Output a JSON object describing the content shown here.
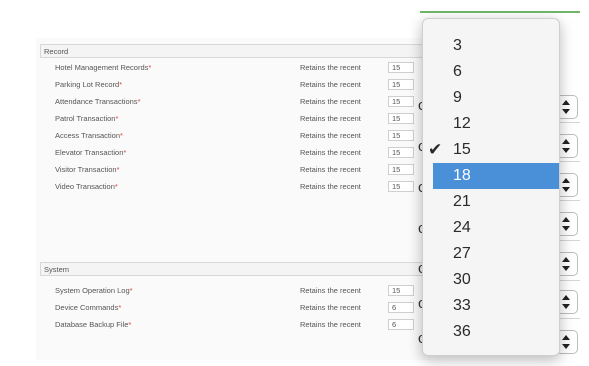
{
  "record_section": {
    "title": "Record",
    "rows": [
      {
        "name": "Hotel Management Records",
        "retain_label": "Retains the recent",
        "value": "15"
      },
      {
        "name": "Parking Lot Record",
        "retain_label": "Retains the recent",
        "value": "15"
      },
      {
        "name": "Attendance Transactions",
        "retain_label": "Retains the recent",
        "value": "15"
      },
      {
        "name": "Patrol Transaction",
        "retain_label": "Retains the recent",
        "value": "15"
      },
      {
        "name": "Access Transaction",
        "retain_label": "Retains the recent",
        "value": "15"
      },
      {
        "name": "Elevator Transaction",
        "retain_label": "Retains the recent",
        "value": "15"
      },
      {
        "name": "Visitor Transaction",
        "retain_label": "Retains the recent",
        "value": "15"
      },
      {
        "name": "Video Transaction",
        "retain_label": "Retains the recent",
        "value": "15"
      }
    ]
  },
  "system_section": {
    "title": "System",
    "rows": [
      {
        "name": "System Operation Log",
        "retain_label": "Retains the recent",
        "value": "15"
      },
      {
        "name": "Device Commands",
        "retain_label": "Retains the recent",
        "value": "6"
      },
      {
        "name": "Database Backup File",
        "retain_label": "Retains the recent",
        "value": "6"
      }
    ]
  },
  "required_marker": "*",
  "background_fragment": "cer",
  "dropdown": {
    "checked": "15",
    "highlighted": "18",
    "options": [
      "3",
      "6",
      "9",
      "12",
      "15",
      "18",
      "21",
      "24",
      "27",
      "30",
      "33",
      "36"
    ]
  },
  "colors": {
    "accent_green": "#6fb66a",
    "selection_blue": "#4a90d9",
    "required_red": "#e04040"
  },
  "icons": {
    "check": "check-icon",
    "stepper": "up-down-arrows-icon"
  }
}
